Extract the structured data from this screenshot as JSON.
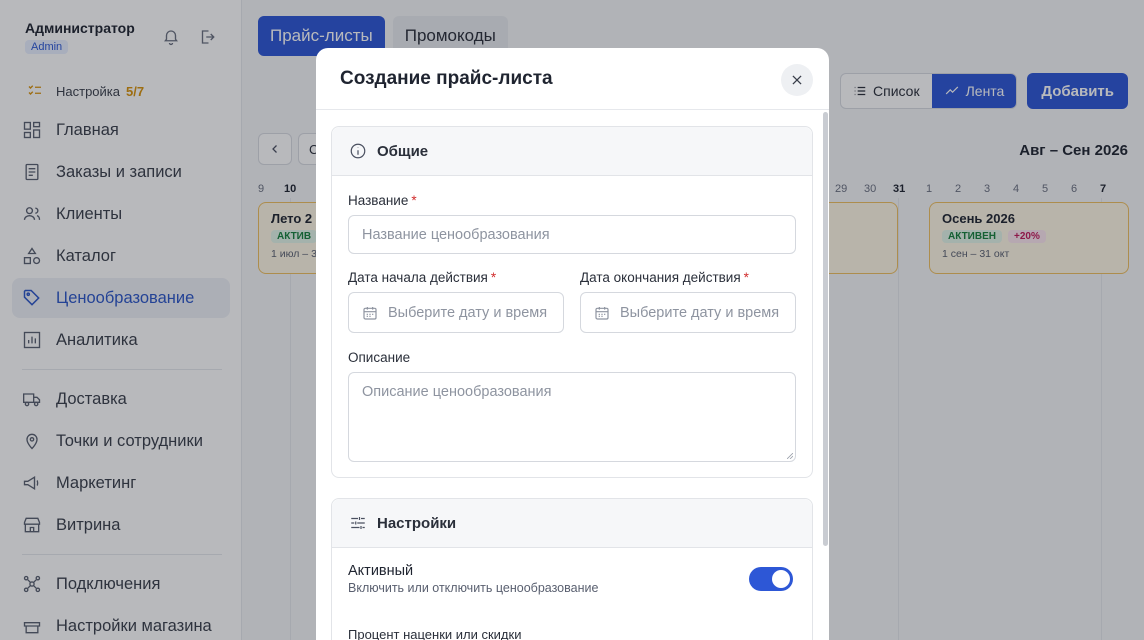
{
  "sidebar": {
    "user_name": "Администратор",
    "user_role": "Admin",
    "setup_label": "Настройка",
    "setup_count": "5/7",
    "items": [
      {
        "label": "Главная",
        "icon": "grid-icon"
      },
      {
        "label": "Заказы и записи",
        "icon": "receipt-icon"
      },
      {
        "label": "Клиенты",
        "icon": "users-icon"
      },
      {
        "label": "Каталог",
        "icon": "shapes-icon"
      },
      {
        "label": "Ценообразование",
        "icon": "tag-icon",
        "active": true
      },
      {
        "label": "Аналитика",
        "icon": "chart-icon"
      },
      {
        "label": "Доставка",
        "icon": "truck-icon"
      },
      {
        "label": "Точки и сотрудники",
        "icon": "map-pin-icon"
      },
      {
        "label": "Маркетинг",
        "icon": "megaphone-icon"
      },
      {
        "label": "Витрина",
        "icon": "store-icon"
      },
      {
        "label": "Подключения",
        "icon": "network-icon"
      },
      {
        "label": "Настройки магазина",
        "icon": "shop-settings-icon"
      }
    ]
  },
  "main": {
    "tabs": [
      {
        "label": "Прайс-листы",
        "active": true
      },
      {
        "label": "Промокоды",
        "active": false
      }
    ],
    "view_list": "Список",
    "view_feed": "Лента",
    "add_label": "Добавить",
    "range_label": "Авг – Сен 2026",
    "nav_button_partial": "С",
    "days_left": [
      "9",
      "10"
    ],
    "days_right": [
      "29",
      "30",
      "31",
      "1",
      "2",
      "3",
      "4",
      "5",
      "6",
      "7"
    ],
    "cards": [
      {
        "title": "Лето 2",
        "status": "АКТИВ",
        "dates": "1 июл – 3"
      },
      {
        "title": "Осень 2026",
        "status": "АКТИВЕН",
        "change": "+20%",
        "dates": "1 сен – 31 окт"
      }
    ]
  },
  "modal": {
    "title": "Создание прайс-листа",
    "general": {
      "header": "Общие",
      "name_label": "Название",
      "name_placeholder": "Название ценообразования",
      "start_label": "Дата начала действия",
      "start_placeholder": "Выберите дату и время",
      "end_label": "Дата окончания действия",
      "end_placeholder": "Выберите дату и время",
      "desc_label": "Описание",
      "desc_placeholder": "Описание ценообразования"
    },
    "settings": {
      "header": "Настройки",
      "active_title": "Активный",
      "active_desc": "Включить или отключить ценообразование",
      "active_on": true,
      "percent_label": "Процент наценки или скидки"
    }
  },
  "colors": {
    "accent": "#2d57d6",
    "required": "#d12d2d",
    "setup_count": "#d9930b"
  }
}
